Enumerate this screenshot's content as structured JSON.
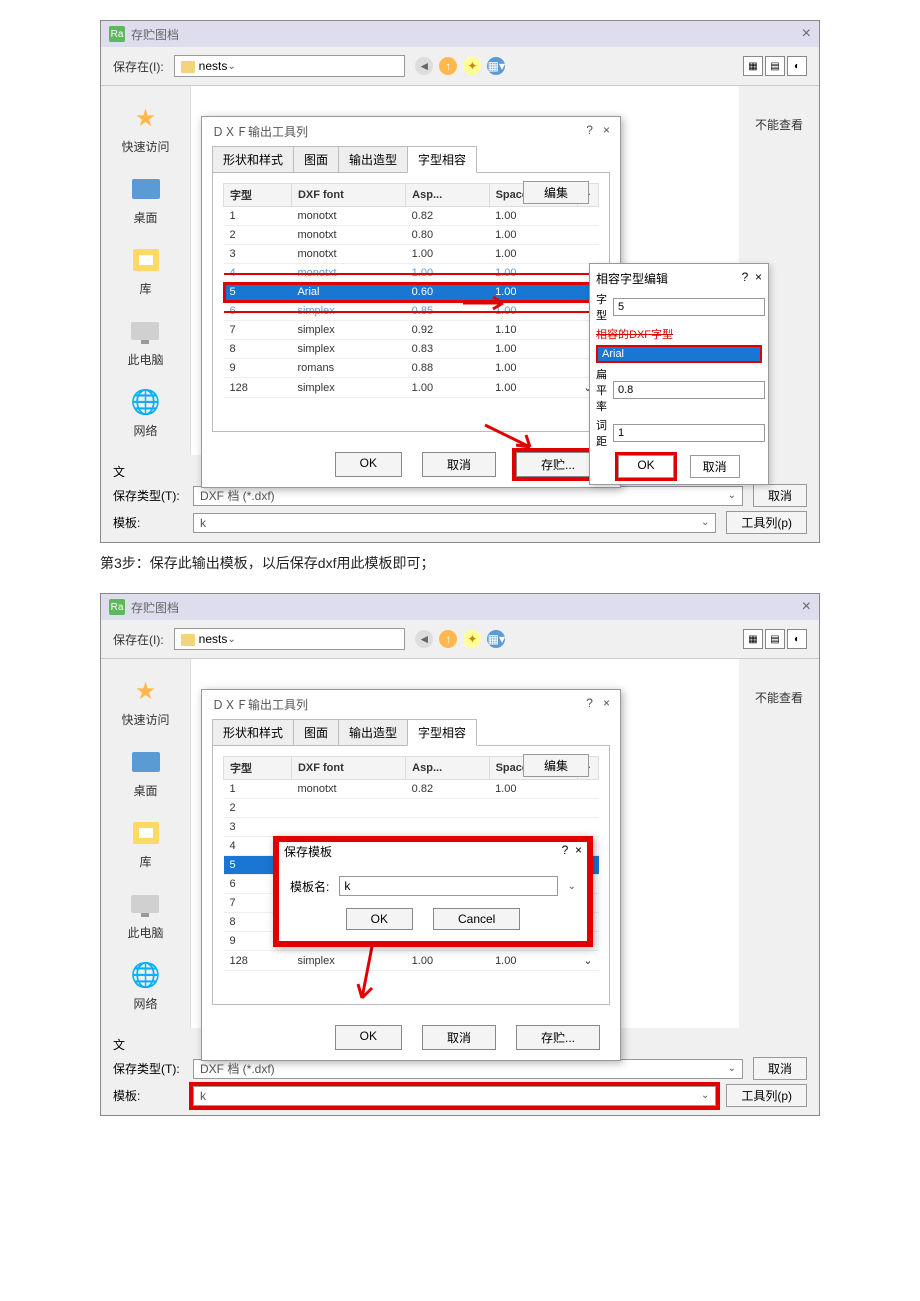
{
  "step3_text": "第3步：保存此输出模板，以后保存dxf用此模板即可；",
  "win": {
    "title": "存贮图档",
    "close": "×"
  },
  "filebar": {
    "save_in": "保存在(I):",
    "path": "nests"
  },
  "sidebar": {
    "quick": "快速访问",
    "desk": "桌面",
    "lib": "库",
    "pc": "此电脑",
    "net": "网络"
  },
  "right": {
    "noview": "不能查看"
  },
  "dxf": {
    "title": "ＤＸＦ输出工具列",
    "help": "?",
    "close": "×",
    "tabs": {
      "shape": "形状和样式",
      "layer": "图面",
      "output": "输出造型",
      "font": "字型相容"
    },
    "th": {
      "font": "字型",
      "dxf": "DXF font",
      "asp": "Asp...",
      "space": "Space"
    },
    "edit": "编集",
    "rows": [
      {
        "n": "1",
        "f": "monotxt",
        "a": "0.82",
        "s": "1.00"
      },
      {
        "n": "2",
        "f": "monotxt",
        "a": "0.80",
        "s": "1.00"
      },
      {
        "n": "3",
        "f": "monotxt",
        "a": "1.00",
        "s": "1.00"
      },
      {
        "n": "4",
        "f": "monotxt",
        "a": "1.00",
        "s": "1.00"
      },
      {
        "n": "5",
        "f": "Arial",
        "a": "0.60",
        "s": "1.00"
      },
      {
        "n": "6",
        "f": "simplex",
        "a": "0.85",
        "s": "1.00"
      },
      {
        "n": "7",
        "f": "simplex",
        "a": "0.92",
        "s": "1.10"
      },
      {
        "n": "8",
        "f": "simplex",
        "a": "0.83",
        "s": "1.00"
      },
      {
        "n": "9",
        "f": "romans",
        "a": "0.88",
        "s": "1.00"
      },
      {
        "n": "128",
        "f": "simplex",
        "a": "1.00",
        "s": "1.00"
      }
    ],
    "ok": "OK",
    "cancel": "取消",
    "save": "存贮..."
  },
  "fontedit": {
    "title": "相容字型编辑",
    "help": "?",
    "close": "×",
    "ftype": "字型",
    "ftype_v": "5",
    "compat": "相容的DXF字型",
    "compat_v": "Arial",
    "flat": "扁平率",
    "flat_v": "0.8",
    "spacing": "词距",
    "spacing_v": "1",
    "ok": "OK",
    "cancel": "取消"
  },
  "fileopts": {
    "filename": "文",
    "filetype_l": "保存类型(T):",
    "filetype_v": "DXF 档 (*.dxf)",
    "tpl": "模板:",
    "tpl_v": "k",
    "cancel": "取消",
    "toolbar": "工具列(p)"
  },
  "savetpl": {
    "title": "保存模板",
    "help": "?",
    "close": "×",
    "name": "模板名:",
    "val": "k",
    "ok": "OK",
    "cancel": "Cancel"
  }
}
